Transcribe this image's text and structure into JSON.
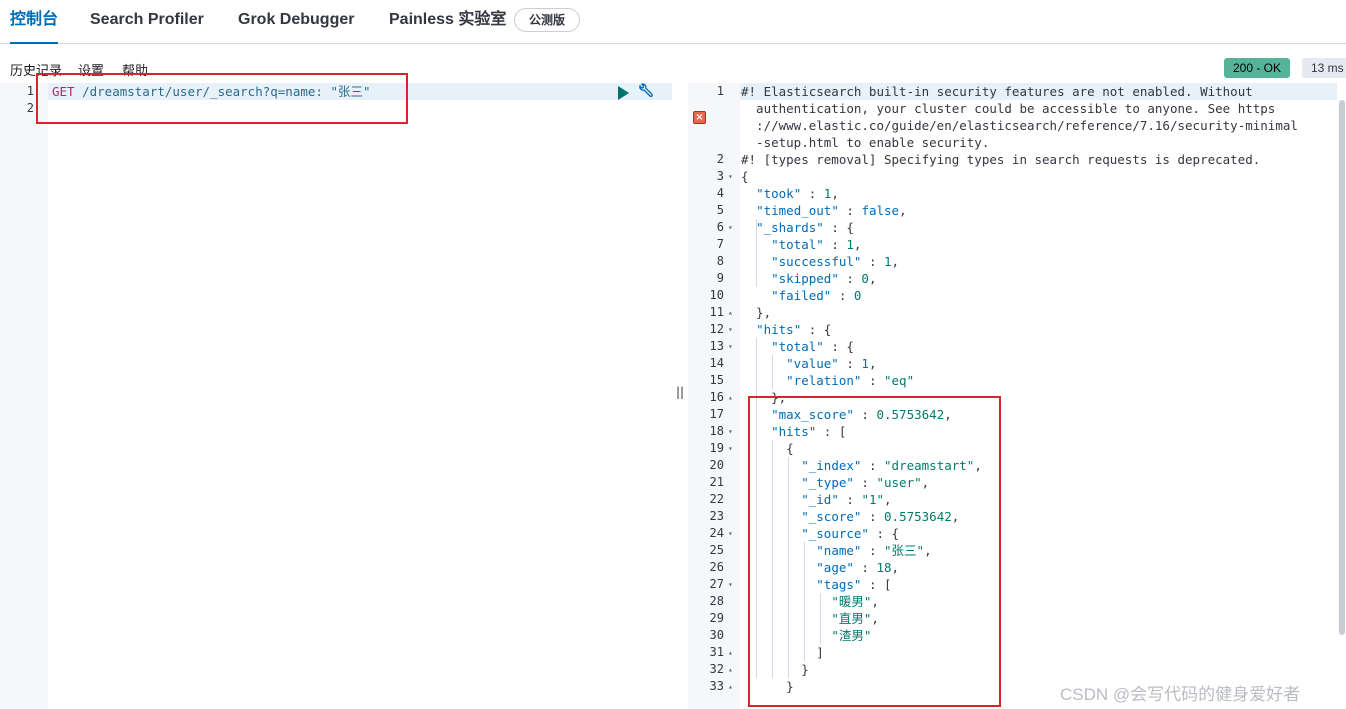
{
  "tabs": [
    {
      "label": "控制台",
      "active": true
    },
    {
      "label": "Search Profiler",
      "active": false
    },
    {
      "label": "Grok Debugger",
      "active": false
    },
    {
      "label": "Painless 实验室",
      "active": false
    }
  ],
  "beta_badge": "公测版",
  "menu": [
    "历史记录",
    "设置",
    "帮助"
  ],
  "status": {
    "code": "200 - OK",
    "time": "13 ms"
  },
  "request": {
    "line_numbers": [
      "1",
      "2"
    ],
    "method": "GET",
    "url": " /dreamstart/user/_search?q=name: \"张三\""
  },
  "response": {
    "line_numbers": [
      "1",
      "2",
      "3",
      "4",
      "5",
      "6",
      "7",
      "8",
      "9",
      "10",
      "11",
      "12",
      "13",
      "14",
      "15",
      "16",
      "17",
      "18",
      "19",
      "20",
      "21",
      "22",
      "23",
      "24",
      "25",
      "26",
      "27",
      "28",
      "29",
      "30",
      "31",
      "32",
      "33"
    ],
    "lines": [
      "#! Elasticsearch built-in security features are not enabled. Without",
      "  authentication, your cluster could be accessible to anyone. See https",
      "  ://www.elastic.co/guide/en/elasticsearch/reference/7.16/security-minimal",
      "  -setup.html to enable security.",
      "#! [types removal] Specifying types in search requests is deprecated.",
      "{",
      "  \"took\" : 1,",
      "  \"timed_out\" : false,",
      "  \"_shards\" : {",
      "    \"total\" : 1,",
      "    \"successful\" : 1,",
      "    \"skipped\" : 0,",
      "    \"failed\" : 0",
      "  },",
      "  \"hits\" : {",
      "    \"total\" : {",
      "      \"value\" : 1,",
      "      \"relation\" : \"eq\"",
      "    },",
      "    \"max_score\" : 0.5753642,",
      "    \"hits\" : [",
      "      {",
      "        \"_index\" : \"dreamstart\",",
      "        \"_type\" : \"user\",",
      "        \"_id\" : \"1\",",
      "        \"_score\" : 0.5753642,",
      "        \"_source\" : {",
      "          \"name\" : \"张三\",",
      "          \"age\" : 18,",
      "          \"tags\" : [",
      "            \"暖男\",",
      "            \"直男\",",
      "            \"渣男\"",
      "          ]",
      "        }",
      "      }"
    ]
  },
  "watermark": "CSDN @会写代码的健身爱好者",
  "colors": {
    "accent": "#006bb8",
    "ok": "#54b399",
    "highlight_box": "#d9232e",
    "method": "#b5286a"
  }
}
